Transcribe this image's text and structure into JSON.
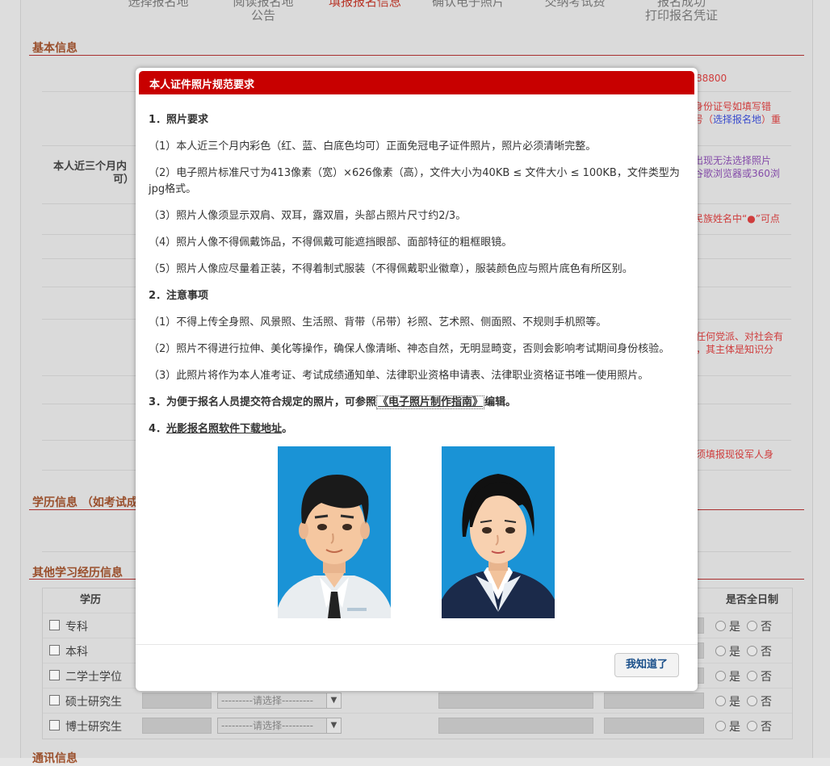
{
  "steps": [
    {
      "label": "选择报名地",
      "active": false
    },
    {
      "label": "阅读报名地\n公告",
      "active": false
    },
    {
      "label": "填报报名信息",
      "active": true
    },
    {
      "label": "确认电子照片",
      "active": false
    },
    {
      "label": "交纳考试费",
      "active": false
    },
    {
      "label": "报名成功\n打印报名凭证",
      "active": false
    }
  ],
  "sections": {
    "basic": "基本信息",
    "education": "学历信息 （如考试成",
    "other_study": "其他学习经历信息",
    "contact": "通讯信息"
  },
  "background": {
    "photo_label_line1": "本人近三个月内",
    "photo_label_line2": "可）",
    "notes": {
      "phone": "88800",
      "id_line1": "身份证号如填写错",
      "id_line2_a": "号（",
      "id_line2_b": "选择报名地",
      "id_line2_c": "）重",
      "browser_line1": "出现无法选择照片",
      "browser_line2": "谷歌浏览器或360浏",
      "ethnic": "民族姓名中“●”可点",
      "party_line1": "任何党派、对社会有",
      "party_line2": "，其主体是知识分",
      "military": "须填报现役军人身"
    }
  },
  "study_table": {
    "headers": {
      "degree": "学历",
      "fulltime": "是否全日制"
    },
    "select_placeholder": "---------请选择---------",
    "yes": "是",
    "no": "否",
    "rows": [
      "专科",
      "本科",
      "二学士学位",
      "硕士研究生",
      "博士研究生"
    ]
  },
  "modal": {
    "title": "本人证件照片规范要求",
    "h1": "1．照片要求",
    "p1": "（1）本人近三个月内彩色（红、蓝、白底色均可）正面免冠电子证件照片，照片必须清晰完整。",
    "p2a": "（2）电子照片标准尺寸为413像素（宽）×626像素（高），文件大小为40KB ≤ 文件大小 ≤ 100KB，文件类型为",
    "p2b": "jpg格式。",
    "p3": "（3）照片人像须显示双肩、双耳，露双眉，头部占照片尺寸约2/3。",
    "p4": "（4）照片人像不得佩戴饰品，不得佩戴可能遮挡眼部、面部特征的粗框眼镜。",
    "p5": "（5）照片人像应尽量着正装，不得着制式服装（不得佩戴职业徽章），服装颜色应与照片底色有所区别。",
    "h2": "2．注意事项",
    "n1": "（1）不得上传全身照、风景照、生活照、背带（吊带）衫照、艺术照、侧面照、不规则手机照等。",
    "n2": "（2）照片不得进行拉伸、美化等操作，确保人像清晰、神态自然，无明显畸变，否则会影响考试期间身份核验。",
    "n3": "（3）此照片将作为本人准考证、考试成绩通知单、法律职业资格申请表、法律职业资格证书唯一使用照片。",
    "h3_pre": "3．为便于报名人员提交符合规定的照片，可参照",
    "h3_link": "《电子照片制作指南》",
    "h3_post": "编辑。",
    "h4_pre": "4．",
    "h4_link": "光影报名照软件下载地址",
    "h4_post": "。",
    "ok_label": "我知道了"
  },
  "colors": {
    "modal_header": "#c80000",
    "photo_bg": "#1a93d6",
    "section_title": "#a0522d",
    "note_red": "#d84040"
  }
}
